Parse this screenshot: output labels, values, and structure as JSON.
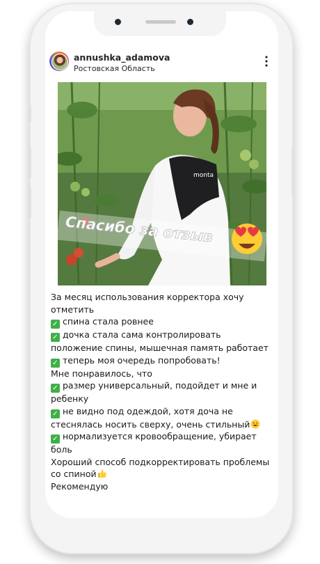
{
  "post": {
    "username": "annushka_adamova",
    "location": "Ростовская Область",
    "photo_overlay_text": "Спасибо за отзыв",
    "corset_brand": "monta",
    "caption": {
      "intro": "За месяц использования корректора хочу отметить",
      "points_1": [
        "спина стала ровнее",
        "дочка стала сама контролировать положение спины, мышечная память работает",
        "теперь моя очередь попробовать!"
      ],
      "liked_heading": "Мне понравилось, что",
      "points_2": [
        "размер универсальный, подойдет и мне и ребенку",
        "не видно под одеждой, хотя доча не стеснялась носить сверху, очень стильный",
        "нормализуется кровообращение, убирает боль"
      ],
      "good_way": "Хороший способ подкорректировать проблемы со спиной",
      "recommend": "Рекомендую"
    },
    "icons": {
      "check": "check-mark-emoji-icon",
      "more": "more-options-icon",
      "heart_eyes": "heart-eyes-emoji-icon",
      "smile": "smiling-face-emoji-icon",
      "thumbs_up": "thumbs-up-emoji-icon"
    },
    "colors": {
      "check_green": "#3fb049",
      "username_text": "#262626"
    }
  }
}
